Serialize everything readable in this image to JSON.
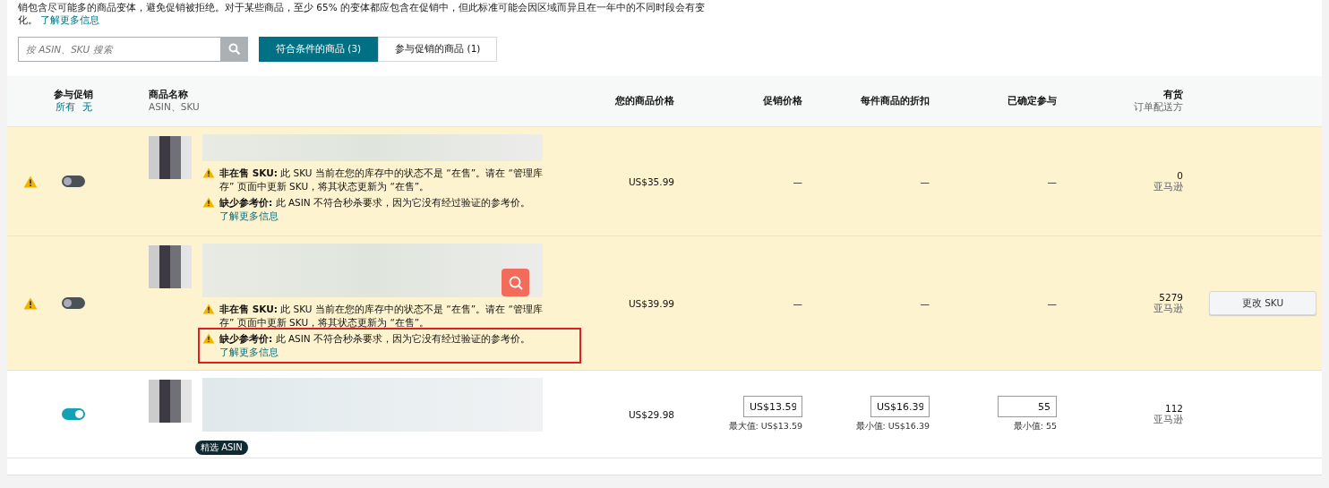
{
  "intro": {
    "text_cut": "销包含尽可能多的商品变体，避免促销被拒绝。对于某些商品，至少 65% 的变体都应包含在促销中，但此标准可能会因区域而异且在一年中的不同时段会有变",
    "text_end": "化。",
    "link": "了解更多信息"
  },
  "search": {
    "placeholder": "按 ASIN、SKU 搜索"
  },
  "tabs": [
    {
      "label": "符合条件的商品 (3)",
      "selected": true
    },
    {
      "label": "参与促销的商品 (1)",
      "selected": false
    }
  ],
  "columns": {
    "participate": {
      "label": "参与促销",
      "links": [
        "所有",
        "无"
      ]
    },
    "product": {
      "label": "商品名称",
      "sub": "ASIN、SKU"
    },
    "price": {
      "label": "您的商品价格"
    },
    "promo_price": {
      "label": "促销价格"
    },
    "discount": {
      "label": "每件商品的折扣"
    },
    "committed": {
      "label": "已确定参与"
    },
    "stock": {
      "label": "有货",
      "sub": "订单配送方"
    }
  },
  "rows": [
    {
      "warning": true,
      "on": false,
      "highlighted": true,
      "alerts": [
        {
          "title": "非在售 SKU:",
          "text": "此 SKU 当前在您的库存中的状态不是 “在售”。请在 “管理库存” 页面中更新 SKU，将其状态更新为 “在售”。",
          "marked": false
        },
        {
          "title": "缺少参考价:",
          "text": "此 ASIN 不符合秒杀要求，因为它没有经过验证的参考价。",
          "link": "了解更多信息",
          "marked": false
        }
      ],
      "price": "US$35.99",
      "promo_price": {
        "kind": "text",
        "text": "—"
      },
      "discount": {
        "kind": "text",
        "text": "—"
      },
      "committed": {
        "kind": "text",
        "text": "—"
      },
      "stock": "0",
      "channel": "亚马逊"
    },
    {
      "warning": true,
      "on": false,
      "highlighted": true,
      "alerts": [
        {
          "title": "非在售 SKU:",
          "text": "此 SKU 当前在您的库存中的状态不是 “在售”。请在 “管理库存” 页面中更新 SKU，将其状态更新为 “在售”。",
          "marked": false
        },
        {
          "title": "缺少参考价:",
          "text": "此 ASIN 不符合秒杀要求，因为它没有经过验证的参考价。",
          "link": "了解更多信息",
          "marked": true
        }
      ],
      "price": "US$39.99",
      "promo_price": {
        "kind": "text",
        "text": "—"
      },
      "discount": {
        "kind": "text",
        "text": "—"
      },
      "committed": {
        "kind": "text",
        "text": "—"
      },
      "stock": "5279",
      "channel": "亚马逊",
      "action": "更改 SKU"
    },
    {
      "warning": false,
      "on": true,
      "highlighted": false,
      "badge": "精选 ASIN",
      "price": "US$29.98",
      "promo_price": {
        "kind": "field",
        "value": "US$13.59",
        "hint": "最大值: US$13.59"
      },
      "discount": {
        "kind": "field",
        "value": "US$16.39",
        "hint": "最小值: US$16.39"
      },
      "committed": {
        "kind": "field",
        "value": "55",
        "hint": "最小值: 55"
      },
      "stock": "112",
      "channel": "亚马逊"
    }
  ]
}
